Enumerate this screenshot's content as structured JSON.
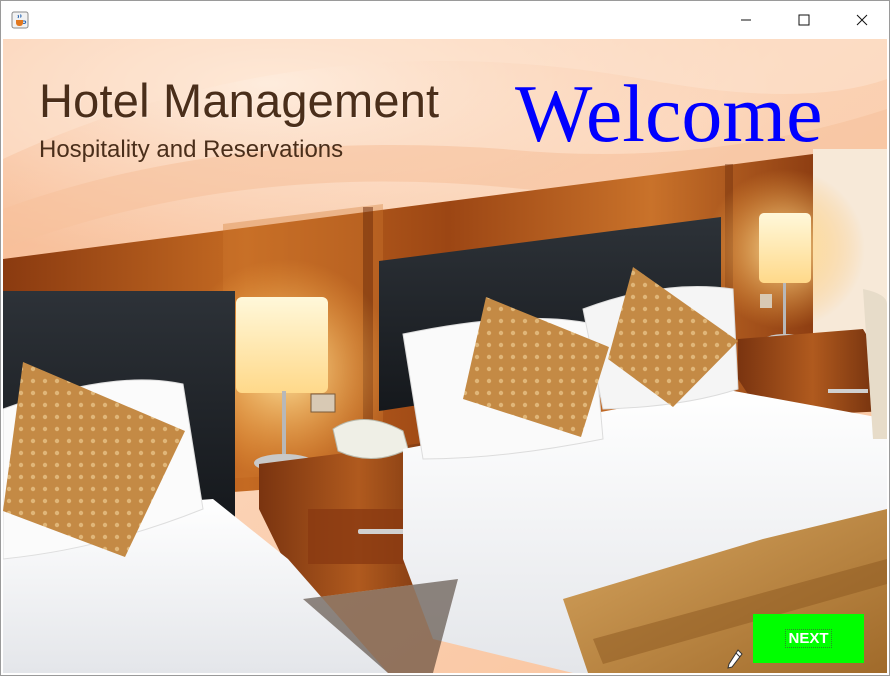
{
  "window": {
    "app_icon": "java-cup-icon",
    "controls": [
      "minimize-icon",
      "maximize-icon",
      "close-icon"
    ]
  },
  "header": {
    "title": "Hotel Management",
    "subtitle": "Hospitality and Reservations",
    "welcome": "Welcome"
  },
  "actions": {
    "next_label": "NEXT"
  },
  "colors": {
    "welcome": "#0000ff",
    "next_button": "#00ff00",
    "brand_text": "#4a2e1a"
  }
}
